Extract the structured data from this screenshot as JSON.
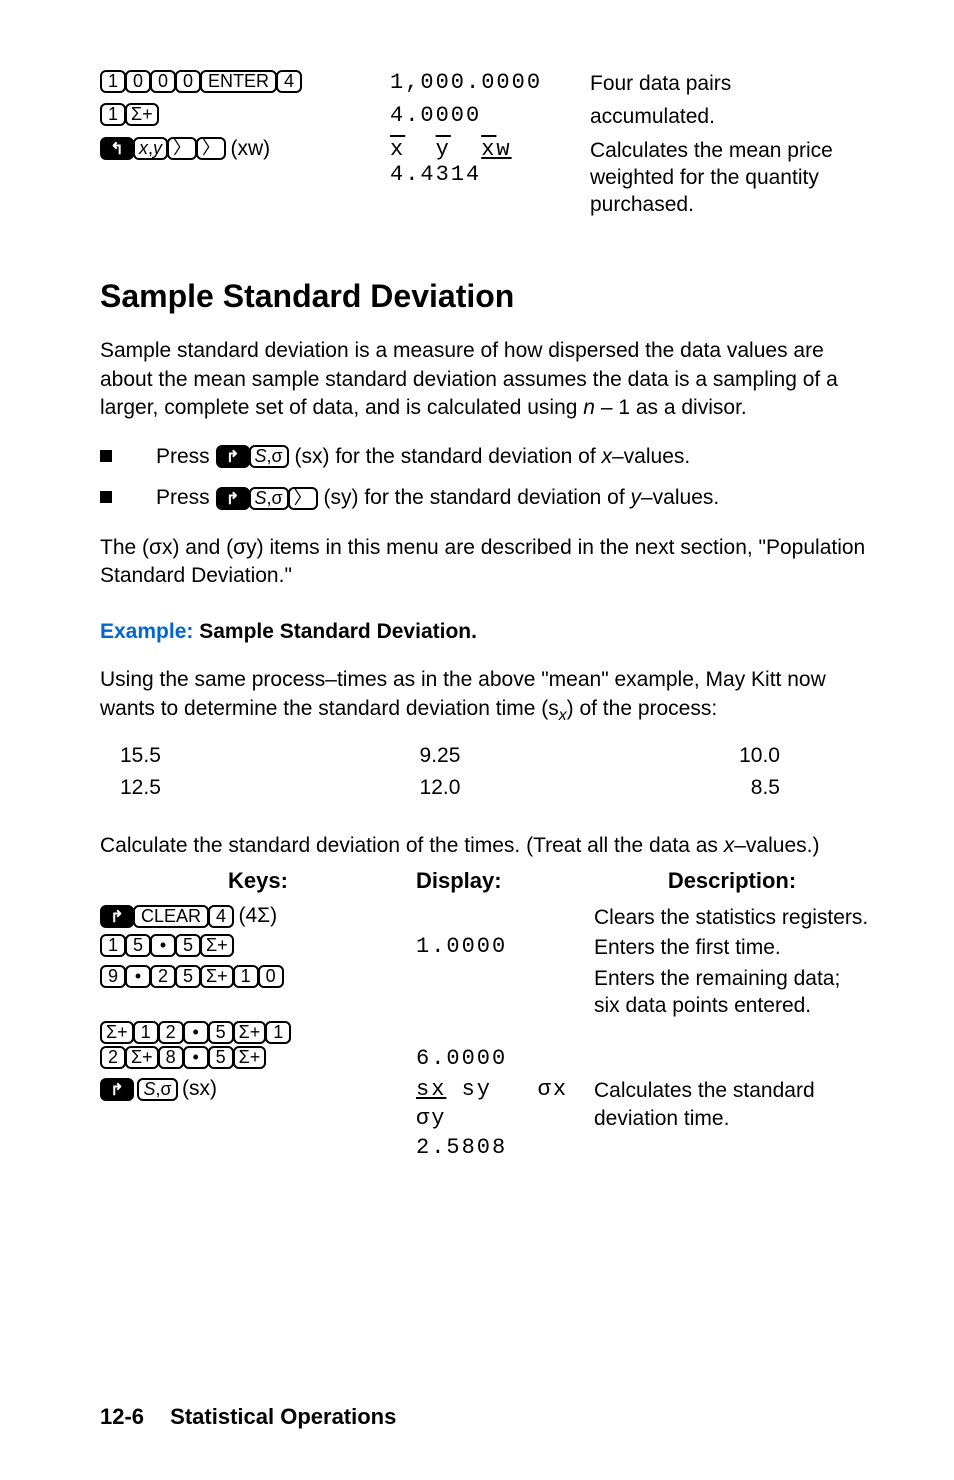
{
  "top": {
    "row1": {
      "keys": [
        "1",
        "0",
        "0",
        "0",
        "ENTER",
        "4"
      ],
      "display": "1,000.0000",
      "desc": "Four data pairs"
    },
    "row2": {
      "keys": [
        "1",
        "Σ+"
      ],
      "display": "4.0000",
      "desc": "accumulated."
    },
    "row3": {
      "display1": "x̄  ȳ  x̄w",
      "display2": "4.4314",
      "desc": "Calculates the mean price weighted for the quantity purchased."
    }
  },
  "section_heading": "Sample Standard Deviation",
  "para1": "Sample standard deviation is a measure of how dispersed the data values are about the mean sample standard deviation assumes the data is a sampling of a larger, complete set of data, and is calculated using ",
  "para1_var": "n",
  "para1_tail": " – 1 as a divisor.",
  "bullet1_a": "Press ",
  "bullet1_b": " (sx) for the standard deviation of ",
  "bullet1_c": "x",
  "bullet1_d": "–values.",
  "bullet2_a": "Press ",
  "bullet2_b": " (sy) for the standard deviation of ",
  "bullet2_c": "y",
  "bullet2_d": "–values.",
  "para2": "The (σx) and (σy) items in this menu are described in the next section, \"Population Standard Deviation.\"",
  "example_label": "Example:",
  "example_title": " Sample Standard Deviation.",
  "para3a": "Using the same process–times as in the above \"mean\" example, May Kitt now wants to determine the standard deviation time (s",
  "para3b": ") of the process:",
  "grid": {
    "r1c1": "15.5",
    "r1c2": "9.25",
    "r1c3": "10.0",
    "r2c1": "12.5",
    "r2c2": "12.0",
    "r2c3": "8.5"
  },
  "para4a": "Calculate the standard deviation of the times. (Treat all the data as ",
  "para4b": "x",
  "para4c": "–values.)",
  "kdd": {
    "h1": "Keys:",
    "h2": "Display:",
    "h3": "Description:",
    "r1_desc": "Clears the statistics registers.",
    "r1_suffix": "(4Σ)",
    "r1_clear": "CLEAR",
    "r1_four": "4",
    "r2_disp": "1.0000",
    "r2_desc": "Enters the first time.",
    "r3_desc": "Enters the remaining data; six data points entered.",
    "r4_disp": "6.0000",
    "r5_disp1": "sx sy   σx",
    "r5_disp2": "σy",
    "r5_disp3": "2.5808",
    "r5_desc": "Calculates the standard deviation time.",
    "r5_suffix": "(sx)"
  },
  "footer_page": "12-6",
  "footer_title": "Statistical Operations"
}
